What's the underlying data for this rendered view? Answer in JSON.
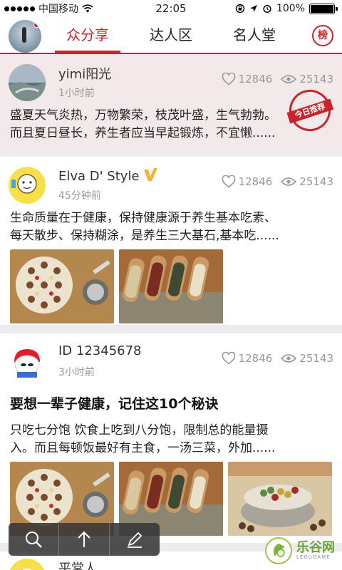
{
  "status_bar": {
    "carrier": "中国移动",
    "time": "22:05",
    "battery": "100%",
    "battery_level": 1.0
  },
  "header": {
    "tabs": [
      "众分享",
      "达人区",
      "名人堂"
    ],
    "active_tab": 0,
    "rank_label": "榜"
  },
  "posts": [
    {
      "author": "yimi阳光",
      "time": "1小时前",
      "likes": "12846",
      "views": "25143",
      "stamp": "今日推荐",
      "text_lines": [
        "盛夏天气炎热，万物繁荣，枝茂叶盛，生气勃勃。",
        "而且夏日昼长，养生者应当早起锻炼，不宜懒......"
      ]
    },
    {
      "author": "Elva D' Style",
      "verified": true,
      "time": "45分钟前",
      "likes": "12846",
      "views": "25143",
      "text_lines": [
        "生命质量在于健康，保持健康源于养生基本吃素、",
        "每天散步、保持糊涂，是养生三大基石,基本吃......"
      ]
    },
    {
      "author": "ID 12345678",
      "time": "3小时前",
      "likes": "12846",
      "views": "25143",
      "title": "要想一辈子健康，记住这10个秘诀",
      "text_lines": [
        "只吃七分饱 饮食上吃到八分饱，限制总的能量摄",
        "入。而且每顿饭最好有主食，一汤三菜，外加......"
      ]
    },
    {
      "author": "平常人"
    }
  ],
  "watermark": {
    "name": "乐谷网",
    "sub": "LEGUGAME"
  },
  "colors": {
    "accent": "#c9242b",
    "pinned_bg": "#f3e9ea",
    "muted": "#999999"
  }
}
